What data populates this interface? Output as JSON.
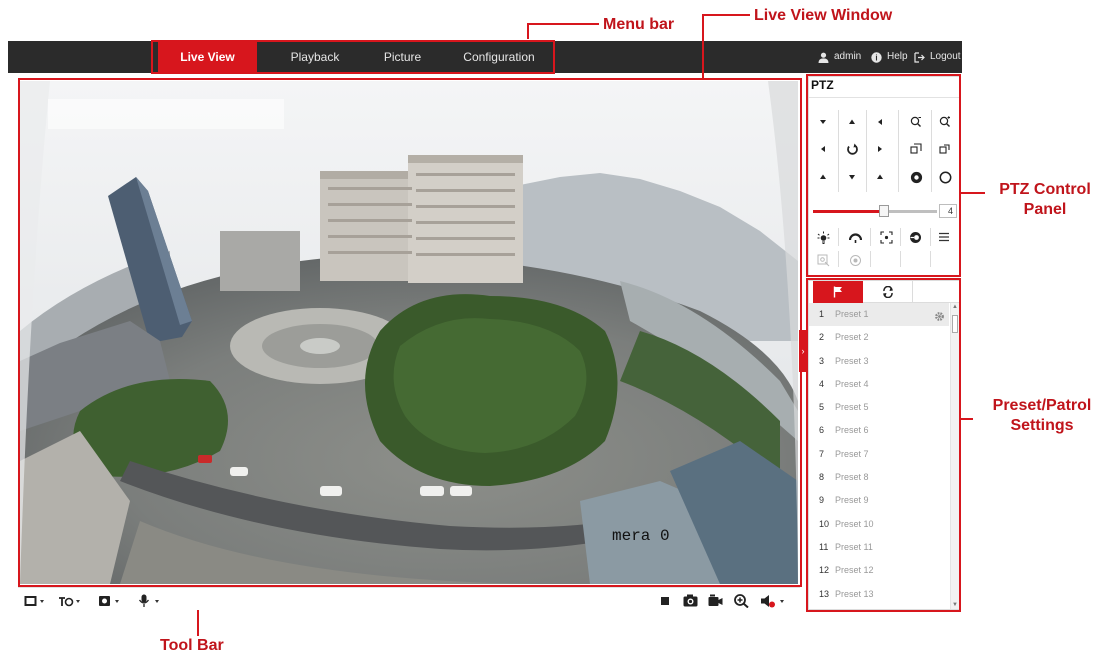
{
  "menu": {
    "tabs": [
      {
        "label": "Live View",
        "active": true
      },
      {
        "label": "Playback",
        "active": false
      },
      {
        "label": "Picture",
        "active": false
      },
      {
        "label": "Configuration",
        "active": false
      }
    ],
    "user_label": "admin",
    "help_label": "Help",
    "logout_label": "Logout"
  },
  "liveview": {
    "osd_text": "mera 0"
  },
  "toolbar": {
    "left_icons": [
      "window-division-icon",
      "stream-type-icon",
      "plugin-icon",
      "microphone-icon"
    ],
    "right_icons": [
      "stop-icon",
      "capture-icon",
      "record-icon",
      "digital-zoom-icon",
      "audio-icon"
    ]
  },
  "ptz": {
    "title": "PTZ",
    "speed_value": "4",
    "speed_level": 4,
    "speed_max": 7
  },
  "preset": {
    "tabs": [
      "preset-flag-icon",
      "patrol-icon"
    ],
    "items": [
      {
        "num": "1",
        "label": "Preset 1"
      },
      {
        "num": "2",
        "label": "Preset 2"
      },
      {
        "num": "3",
        "label": "Preset 3"
      },
      {
        "num": "4",
        "label": "Preset 4"
      },
      {
        "num": "5",
        "label": "Preset 5"
      },
      {
        "num": "6",
        "label": "Preset 6"
      },
      {
        "num": "7",
        "label": "Preset 7"
      },
      {
        "num": "8",
        "label": "Preset 8"
      },
      {
        "num": "9",
        "label": "Preset 9"
      },
      {
        "num": "10",
        "label": "Preset 10"
      },
      {
        "num": "11",
        "label": "Preset 11"
      },
      {
        "num": "12",
        "label": "Preset 12"
      },
      {
        "num": "13",
        "label": "Preset 13"
      }
    ]
  },
  "annotations": {
    "menu_bar": "Menu bar",
    "live_view_window": "Live View Window",
    "ptz_panel": "PTZ Control Panel",
    "preset_settings": "Preset/Patrol Settings",
    "tool_bar": "Tool Bar"
  },
  "colors": {
    "accent": "#d7161d",
    "menubar": "#2b2b2b",
    "annotation": "#c0141b"
  }
}
